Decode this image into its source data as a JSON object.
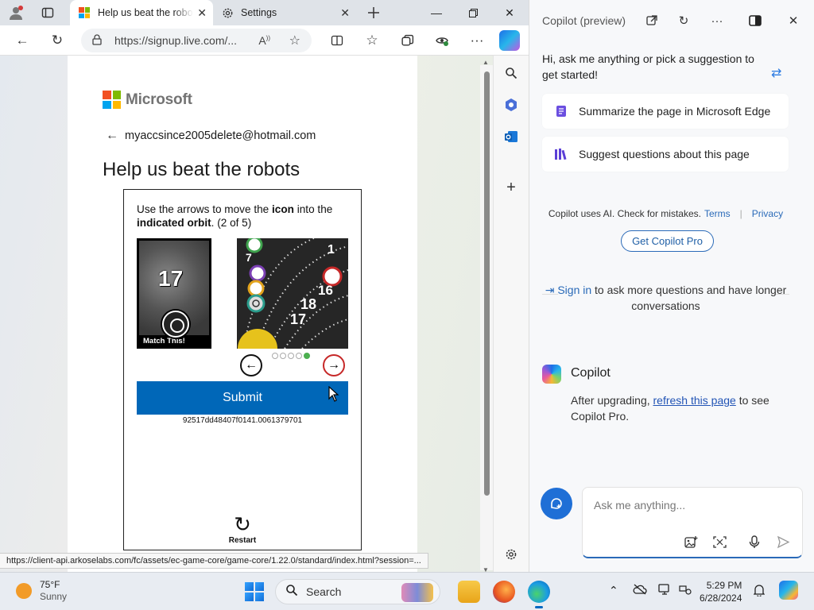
{
  "browser": {
    "tabs": [
      {
        "title": "Help us beat the robots",
        "favicon": "microsoft-logo"
      },
      {
        "title": "Settings",
        "favicon": "gear-icon"
      }
    ],
    "url_display": "https://signup.live.com/...",
    "status_url": "https://client-api.arkoselabs.com/fc/assets/ec-game-core/game-core/1.22.0/standard/index.html?session=..."
  },
  "page": {
    "brand": "Microsoft",
    "account_email": "myaccsince2005delete@hotmail.com",
    "heading": "Help us beat the robots",
    "puzzle": {
      "instruction_parts": {
        "p1": "Use the arrows to move the ",
        "icon": "icon",
        "p2": " into the ",
        "orbit": "indicated orbit",
        "p3": ". (2 of 5)"
      },
      "match_number": "17",
      "match_label": "Match This!",
      "orbit_numbers": [
        "1",
        "7",
        "16",
        "18",
        "17"
      ],
      "pagination": {
        "total": 5,
        "current": 5
      },
      "submit_label": "Submit",
      "session_id": "92517dd48407f0141.0061379701",
      "restart_label": "Restart"
    }
  },
  "copilot": {
    "title": "Copilot (preview)",
    "greeting": "Hi, ask me anything or pick a suggestion to get started!",
    "suggestions": [
      {
        "label": "Summarize the page in Microsoft Edge",
        "icon": "document-icon"
      },
      {
        "label": "Suggest questions about this page",
        "icon": "books-icon"
      }
    ],
    "disclaimer": "Copilot uses AI. Check for mistakes.",
    "terms_label": "Terms",
    "privacy_label": "Privacy",
    "get_pro_label": "Get Copilot Pro",
    "signin_link": "Sign in",
    "signin_rest": "to ask more questions and have longer conversations",
    "bot_name": "Copilot",
    "message": {
      "before": "After upgrading, ",
      "link": "refresh this page",
      "after": " to see Copilot Pro."
    },
    "input_placeholder": "Ask me anything..."
  },
  "taskbar": {
    "temperature": "75°F",
    "condition": "Sunny",
    "search_label": "Search",
    "time": "5:29 PM",
    "date": "6/28/2024"
  },
  "colors": {
    "submit_blue": "#0067b8",
    "edge_accent": "#2a6ab8",
    "tab_bar": "#dfe3e8"
  }
}
